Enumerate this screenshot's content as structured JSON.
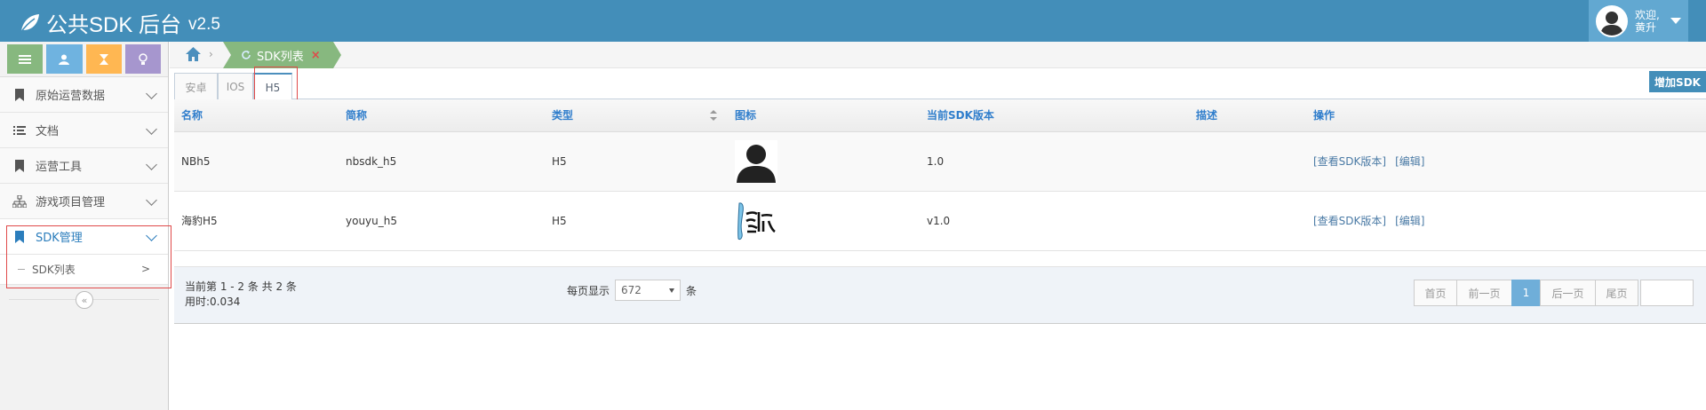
{
  "app": {
    "title": "公共SDK 后台",
    "version": "v2.5"
  },
  "user": {
    "welcome": "欢迎,",
    "name": "黄升"
  },
  "sidebar": {
    "shortcuts": [
      "list-icon",
      "user-icon",
      "hourglass-icon",
      "lightbulb-icon"
    ],
    "items": [
      {
        "label": "原始运营数据",
        "icon": "bookmark-icon"
      },
      {
        "label": "文档",
        "icon": "list-icon"
      },
      {
        "label": "运营工具",
        "icon": "bookmark-icon"
      },
      {
        "label": "游戏项目管理",
        "icon": "sitemap-icon"
      },
      {
        "label": "SDK管理",
        "icon": "bookmark-icon",
        "active": true
      }
    ],
    "sub_item": {
      "label": "SDK列表",
      "arrow": ">"
    },
    "collapse": "«"
  },
  "breadcrumb": {
    "sep": "›",
    "tab_label": "SDK列表",
    "close": "×"
  },
  "tabs": [
    {
      "label": "安卓"
    },
    {
      "label": "IOS"
    },
    {
      "label": "H5",
      "active": true
    }
  ],
  "add_button": "增加SDK",
  "table": {
    "headers": [
      "名称",
      "简称",
      "类型",
      "图标",
      "当前SDK版本",
      "描述",
      "操作"
    ],
    "rows": [
      {
        "name": "NBh5",
        "short": "nbsdk_h5",
        "type": "H5",
        "icon": "default-avatar",
        "version": "1.0",
        "desc": "",
        "ops": [
          "[查看SDK版本]",
          "[编辑]"
        ]
      },
      {
        "name": "海豹H5",
        "short": "youyu_h5",
        "type": "H5",
        "icon": "seal-logo",
        "version": "v1.0",
        "desc": "",
        "ops": [
          "[查看SDK版本]",
          "[编辑]"
        ]
      }
    ]
  },
  "footer": {
    "record_info": "当前第 1 - 2 条 共 2 条",
    "time_info": "用时:0.034",
    "per_page_label": "每页显示",
    "per_page_value": "672",
    "per_page_unit": "条",
    "pager": [
      "首页",
      "前一页",
      "1",
      "后一页",
      "尾页"
    ],
    "current_page": "1"
  },
  "colors": {
    "navbar": "#438eb9",
    "accent": "#307ecc",
    "green": "#87b87f",
    "highlight": "#e04a4a"
  }
}
